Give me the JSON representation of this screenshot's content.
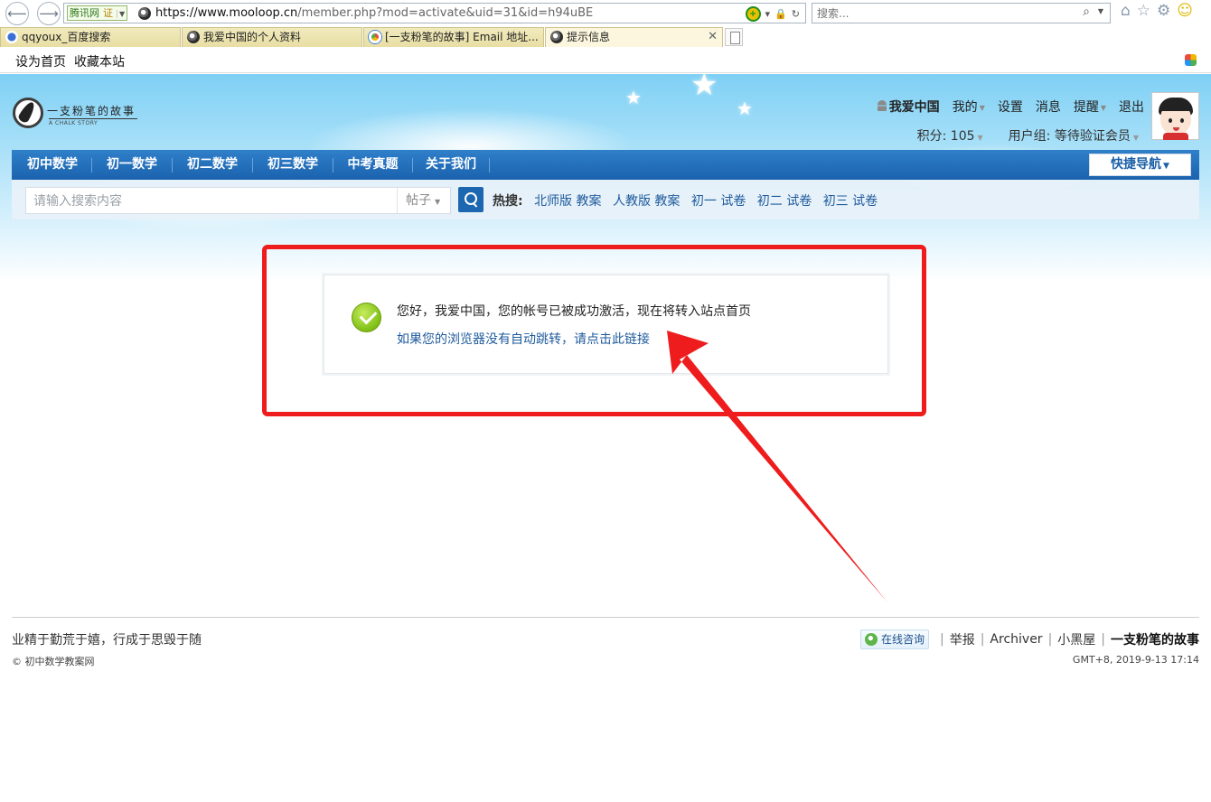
{
  "browser": {
    "badge_site": "腾讯网",
    "badge_cert": "证",
    "url_host": "https://www.mooloop.cn",
    "url_path": "/member.php?mod=activate&uid=31&id=h94uBE",
    "search_placeholder": "搜索...",
    "tabs": [
      {
        "title": "qqyoux_百度搜索"
      },
      {
        "title": "我爱中国的个人资料"
      },
      {
        "title": "[一支粉笔的故事] Email 地址..."
      },
      {
        "title": "提示信息"
      }
    ],
    "menu": {
      "set_home": "设为首页",
      "bookmark": "收藏本站"
    }
  },
  "site": {
    "logo_name": "一支粉笔的故事",
    "logo_sub": "A CHALK STORY",
    "user": {
      "name": "我爱中国",
      "my": "我的",
      "settings": "设置",
      "messages": "消息",
      "alerts": "提醒",
      "logout": "退出",
      "points": "积分: 105",
      "group": "用户组: 等待验证会员"
    },
    "nav": [
      "初中数学",
      "初一数学",
      "初二数学",
      "初三数学",
      "中考真题",
      "关于我们"
    ],
    "quick_nav": "快捷导航",
    "search": {
      "placeholder": "请输入搜索内容",
      "type": "帖子",
      "hot_label": "热搜:",
      "hot": [
        "北师版 教案",
        "人教版 教案",
        "初一 试卷",
        "初二 试卷",
        "初三 试卷"
      ]
    }
  },
  "message": {
    "main": "您好，我爱中国，您的帐号已被成功激活，现在将转入站点首页",
    "link": "如果您的浏览器没有自动跳转，请点击此链接"
  },
  "footer": {
    "slogan": "业精于勤荒于嬉，行成于思毁于随",
    "copyright": "© 初中数学教案网",
    "consult": "在线咨询",
    "report": "举报",
    "archiver": "Archiver",
    "dark_room": "小黑屋",
    "site_name": "一支粉笔的故事",
    "time": "GMT+8, 2019-9-13 17:14"
  },
  "colors": {
    "accent": "#1b62ae",
    "link": "#1e5a9c",
    "annotation": "#ee1c1c"
  }
}
